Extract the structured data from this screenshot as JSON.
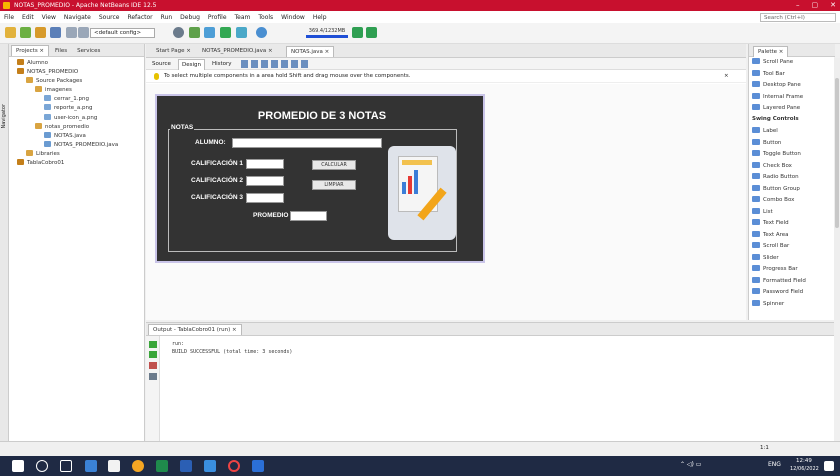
{
  "window": {
    "title": "NOTAS_PROMEDIO - Apache NetBeans IDE 12.5"
  },
  "menu": [
    "File",
    "Edit",
    "View",
    "Navigate",
    "Source",
    "Refactor",
    "Run",
    "Debug",
    "Profile",
    "Team",
    "Tools",
    "Window",
    "Help"
  ],
  "search": {
    "placeholder": "Search (Ctrl+I)"
  },
  "toolbar": {
    "config": "<default config>",
    "memory": "369.4/1232MB"
  },
  "navigator_label": "Navigator",
  "project_tabs": [
    "Projects ×",
    "Files",
    "Services"
  ],
  "tree": [
    {
      "label": "Alumno",
      "indent": 0,
      "color": "#c47f1a"
    },
    {
      "label": "NOTAS_PROMEDIO",
      "indent": 0,
      "color": "#c47f1a"
    },
    {
      "label": "Source Packages",
      "indent": 1,
      "color": "#d9a441"
    },
    {
      "label": "imagenes",
      "indent": 2,
      "color": "#d9a441"
    },
    {
      "label": "cerrar_1.png",
      "indent": 3,
      "color": "#7aa6d6"
    },
    {
      "label": "reporte_a.png",
      "indent": 3,
      "color": "#7aa6d6"
    },
    {
      "label": "user-icon_a.png",
      "indent": 3,
      "color": "#7aa6d6"
    },
    {
      "label": "notas_promedio",
      "indent": 2,
      "color": "#d9a441"
    },
    {
      "label": "NOTAS.java",
      "indent": 3,
      "color": "#6a9bd1"
    },
    {
      "label": "NOTAS_PROMEDIO.java",
      "indent": 3,
      "color": "#6a9bd1"
    },
    {
      "label": "Libraries",
      "indent": 1,
      "color": "#d9a441"
    },
    {
      "label": "TablaCobro01",
      "indent": 0,
      "color": "#c47f1a"
    }
  ],
  "editor": {
    "tabs": [
      "Start Page ×",
      "NOTAS_PROMEDIO.java ×",
      "NOTAS.java ×"
    ],
    "modes": [
      "Source",
      "Design",
      "History"
    ],
    "hint": "To select multiple components in a area hold Shift and drag mouse over the components.",
    "close": "×"
  },
  "form": {
    "title": "PROMEDIO DE 3 NOTAS",
    "group": "NOTAS",
    "alumno_label": "ALUMNO:",
    "cal1_label": "CALIFICACIÓN 1",
    "cal2_label": "CALIFICACIÓN 2",
    "cal3_label": "CALIFICACIÓN 3",
    "promedio_label": "PROMEDIO",
    "calcular": "CALCULAR",
    "limpiar": "LIMPIAR"
  },
  "palette": {
    "tab": "Palette ×",
    "items": [
      {
        "label": "Scroll Pane",
        "bold": false
      },
      {
        "label": "Tool Bar",
        "bold": false
      },
      {
        "label": "Desktop Pane",
        "bold": false
      },
      {
        "label": "Internal Frame",
        "bold": false
      },
      {
        "label": "Layered Pane",
        "bold": false
      },
      {
        "label": "Swing Controls",
        "bold": true
      },
      {
        "label": "Label",
        "bold": false
      },
      {
        "label": "Button",
        "bold": false
      },
      {
        "label": "Toggle Button",
        "bold": false
      },
      {
        "label": "Check Box",
        "bold": false
      },
      {
        "label": "Radio Button",
        "bold": false
      },
      {
        "label": "Button Group",
        "bold": false
      },
      {
        "label": "Combo Box",
        "bold": false
      },
      {
        "label": "List",
        "bold": false
      },
      {
        "label": "Text Field",
        "bold": false
      },
      {
        "label": "Text Area",
        "bold": false
      },
      {
        "label": "Scroll Bar",
        "bold": false
      },
      {
        "label": "Slider",
        "bold": false
      },
      {
        "label": "Progress Bar",
        "bold": false
      },
      {
        "label": "Formatted Field",
        "bold": false
      },
      {
        "label": "Password Field",
        "bold": false
      },
      {
        "label": "Spinner",
        "bold": false
      }
    ]
  },
  "output": {
    "tab": "Output - TablaCobro01 (run) ×",
    "lines": [
      "run:",
      "BUILD SUCCESSFUL (total time: 3 seconds)"
    ]
  },
  "status": {
    "position": "1:1"
  },
  "taskbar": {
    "lang": "ENG",
    "time": "12:49",
    "date": "12/06/2022"
  }
}
